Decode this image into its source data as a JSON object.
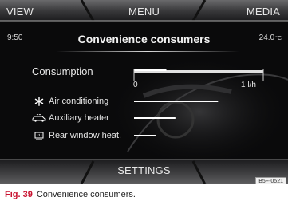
{
  "tabs": {
    "view": "VIEW",
    "menu": "MENU",
    "media": "MEDIA"
  },
  "status": {
    "time": "9:50",
    "temperature": "24.0",
    "temperature_unit": "°C"
  },
  "title": "Convenience consumers",
  "consumption": {
    "label": "Consumption",
    "scale_min": "0",
    "scale_max": "1 l/h",
    "level": 0.25,
    "items": [
      {
        "label": "Air conditioning",
        "icon": "snowflake-icon",
        "level": 0.65
      },
      {
        "label": "Auxiliary heater",
        "icon": "auxiliary-heater-icon",
        "level": 0.32
      },
      {
        "label": "Rear window heat.",
        "icon": "rear-window-heater-icon",
        "level": 0.17
      }
    ]
  },
  "bottom": {
    "settings": "SETTINGS"
  },
  "image_code": "B5F-0521",
  "caption": {
    "fig": "Fig. 39",
    "text": "Convenience consumers."
  },
  "colors": {
    "background": "#0a0a0b",
    "text": "#e6e6e6",
    "bar": "#ffffff",
    "caption_accent": "#c8102e"
  }
}
